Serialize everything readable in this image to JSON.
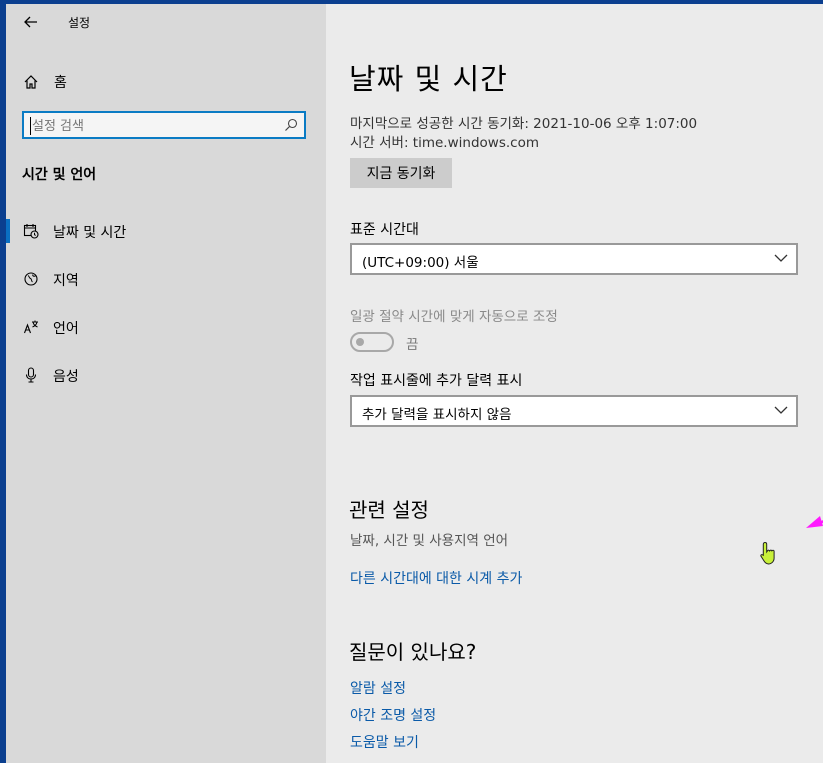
{
  "app": {
    "title": "설정"
  },
  "sidebar": {
    "home_label": "홈",
    "search_placeholder": "설정 검색",
    "section_title": "시간 및 언어",
    "items": [
      {
        "label": "날짜 및 시간",
        "icon": "date-time-icon",
        "selected": true
      },
      {
        "label": "지역",
        "icon": "globe-icon",
        "selected": false
      },
      {
        "label": "언어",
        "icon": "language-icon",
        "selected": false
      },
      {
        "label": "음성",
        "icon": "microphone-icon",
        "selected": false
      }
    ]
  },
  "main": {
    "title": "날짜 및 시간",
    "last_sync": "마지막으로 성공한 시간 동기화: 2021-10-06 오후 1:07:00",
    "time_server": "시간 서버: time.windows.com",
    "sync_button": "지금 동기화",
    "timezone_label": "표준 시간대",
    "timezone_value": "(UTC+09:00) 서울",
    "dst_label": "일광 절약 시간에 맞게 자동으로 조정",
    "dst_toggle_state": "끔",
    "calendar_label": "작업 표시줄에 추가 달력 표시",
    "calendar_value": "추가 달력을 표시하지 않음",
    "related_title": "관련 설정",
    "related_links": [
      "날짜, 시간 및 사용지역 언어",
      "다른 시간대에 대한 시계 추가"
    ],
    "qa_title": "질문이 있나요?",
    "qa_links": [
      "알람 설정",
      "야간 조명 설정",
      "도움말 보기"
    ]
  },
  "colors": {
    "accent": "#0a6fc2",
    "link": "#0a5aa8",
    "annotation_arrow": "#ff19ff"
  }
}
